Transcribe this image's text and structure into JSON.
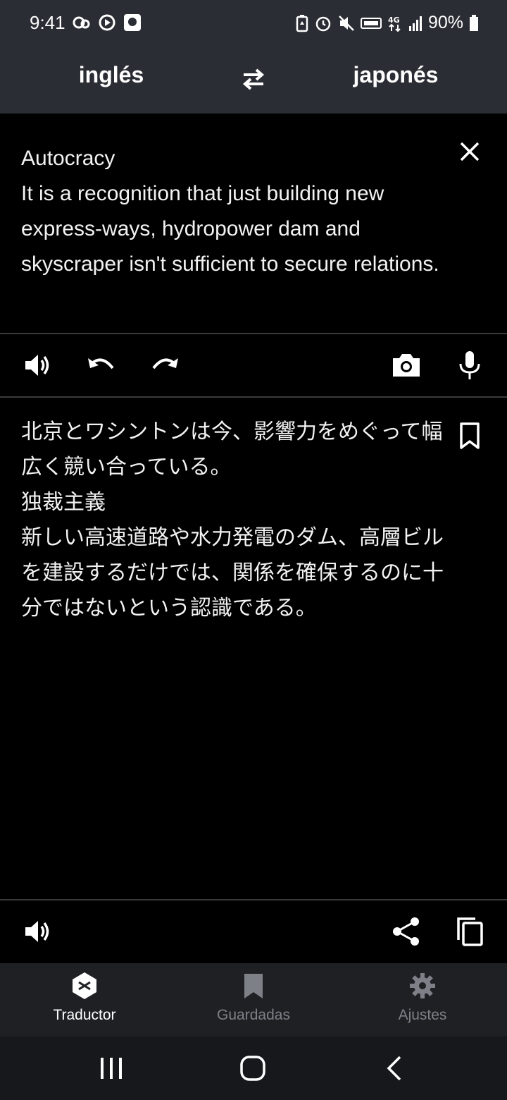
{
  "status_bar": {
    "time": "9:41",
    "battery_percent": "90%",
    "left_icons": [
      "link-icon",
      "record-icon",
      "app-icon"
    ],
    "right_icons": [
      "battery-saver-icon",
      "alarm-icon",
      "mute-icon",
      "volte-icon",
      "4g-icon",
      "signal-icon",
      "battery-icon"
    ]
  },
  "language_bar": {
    "source_language": "inglés",
    "target_language": "japonés",
    "swap_icon": "swap-arrows-icon"
  },
  "source": {
    "text": "Autocracy\nIt is a recognition that just building new express-ways, hydropower dam and skyscraper isn't sufficient to secure relations.",
    "clear_icon": "close-icon"
  },
  "source_toolbar": {
    "icons": [
      "speaker-icon",
      "undo-icon",
      "redo-icon",
      "camera-icon",
      "microphone-icon"
    ]
  },
  "result": {
    "text": "北京とワシントンは今、影響力をめぐって幅広く競い合っている。\n独裁主義\n新しい高速道路や水力発電のダム、高層ビルを建設するだけでは、関係を確保するのに十分ではないという認識である。",
    "bookmark_icon": "bookmark-icon"
  },
  "result_toolbar": {
    "icons": [
      "speaker-icon",
      "share-icon",
      "copy-icon"
    ]
  },
  "bottom_nav": {
    "items": [
      {
        "label": "Traductor",
        "icon": "translator-icon",
        "active": true
      },
      {
        "label": "Guardadas",
        "icon": "bookmark-icon",
        "active": false
      },
      {
        "label": "Ajustes",
        "icon": "gear-icon",
        "active": false
      }
    ]
  },
  "system_nav": {
    "icons": [
      "recents-icon",
      "home-icon",
      "back-icon"
    ]
  },
  "colors": {
    "header_bg": "#2a2d33",
    "content_bg": "#000000",
    "nav_bg": "#1f2024",
    "text_primary": "#ffffff",
    "text_inactive": "#7d8087"
  }
}
